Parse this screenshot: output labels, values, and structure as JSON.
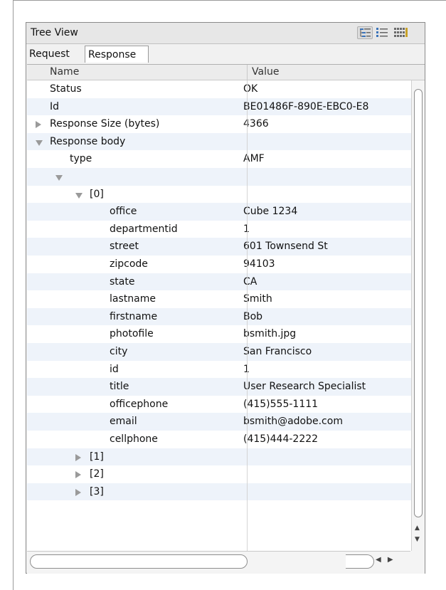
{
  "panel": {
    "title": "Tree View",
    "view_buttons": [
      {
        "icon": "tree-view-icon",
        "selected": true
      },
      {
        "icon": "list-view-icon",
        "selected": false
      },
      {
        "icon": "grid-view-icon",
        "selected": false
      }
    ]
  },
  "tabs": [
    {
      "label": "Request",
      "active": false
    },
    {
      "label": "Response",
      "active": true
    }
  ],
  "table": {
    "columns": [
      "Name",
      "Value"
    ],
    "rows": [
      {
        "name": "Status",
        "value": "OK",
        "depth": 0,
        "toggle": "none"
      },
      {
        "name": "Id",
        "value": "BE01486F-890E-EBC0-E8",
        "depth": 0,
        "toggle": "none"
      },
      {
        "name": "Response Size (bytes)",
        "value": "4366",
        "depth": 0,
        "toggle": "collapsed"
      },
      {
        "name": "Response body",
        "value": "",
        "depth": 0,
        "toggle": "expanded"
      },
      {
        "name": "type",
        "value": "AMF",
        "depth": 1,
        "toggle": "none"
      },
      {
        "name": "",
        "value": "",
        "depth": 1,
        "toggle": "expanded"
      },
      {
        "name": "[0]",
        "value": "",
        "depth": 2,
        "toggle": "expanded"
      },
      {
        "name": "office",
        "value": "Cube 1234",
        "depth": 3,
        "toggle": "none"
      },
      {
        "name": "departmentid",
        "value": "1",
        "depth": 3,
        "toggle": "none"
      },
      {
        "name": "street",
        "value": "601 Townsend St",
        "depth": 3,
        "toggle": "none"
      },
      {
        "name": "zipcode",
        "value": "94103",
        "depth": 3,
        "toggle": "none"
      },
      {
        "name": "state",
        "value": "CA",
        "depth": 3,
        "toggle": "none"
      },
      {
        "name": "lastname",
        "value": "Smith",
        "depth": 3,
        "toggle": "none"
      },
      {
        "name": "firstname",
        "value": "Bob",
        "depth": 3,
        "toggle": "none"
      },
      {
        "name": "photofile",
        "value": "bsmith.jpg",
        "depth": 3,
        "toggle": "none"
      },
      {
        "name": "city",
        "value": "San Francisco",
        "depth": 3,
        "toggle": "none"
      },
      {
        "name": "id",
        "value": "1",
        "depth": 3,
        "toggle": "none"
      },
      {
        "name": "title",
        "value": "User Research Specialist",
        "depth": 3,
        "toggle": "none"
      },
      {
        "name": "officephone",
        "value": "(415)555-1111",
        "depth": 3,
        "toggle": "none"
      },
      {
        "name": "email",
        "value": "bsmith@adobe.com",
        "depth": 3,
        "toggle": "none"
      },
      {
        "name": "cellphone",
        "value": "(415)444-2222",
        "depth": 3,
        "toggle": "none"
      },
      {
        "name": "[1]",
        "value": "",
        "depth": 2,
        "toggle": "collapsed"
      },
      {
        "name": "[2]",
        "value": "",
        "depth": 2,
        "toggle": "collapsed"
      },
      {
        "name": "[3]",
        "value": "",
        "depth": 2,
        "toggle": "collapsed"
      }
    ]
  },
  "scrollbar_icons": {
    "up": "scroll-up-arrow-icon",
    "down": "scroll-down-arrow-icon",
    "left": "scroll-left-arrow-icon",
    "right": "scroll-right-arrow-icon"
  },
  "colors": {
    "alt_row": "#eef3fa",
    "panel_bg": "#f1f1f1",
    "icon_blue": "#3b73b9"
  }
}
